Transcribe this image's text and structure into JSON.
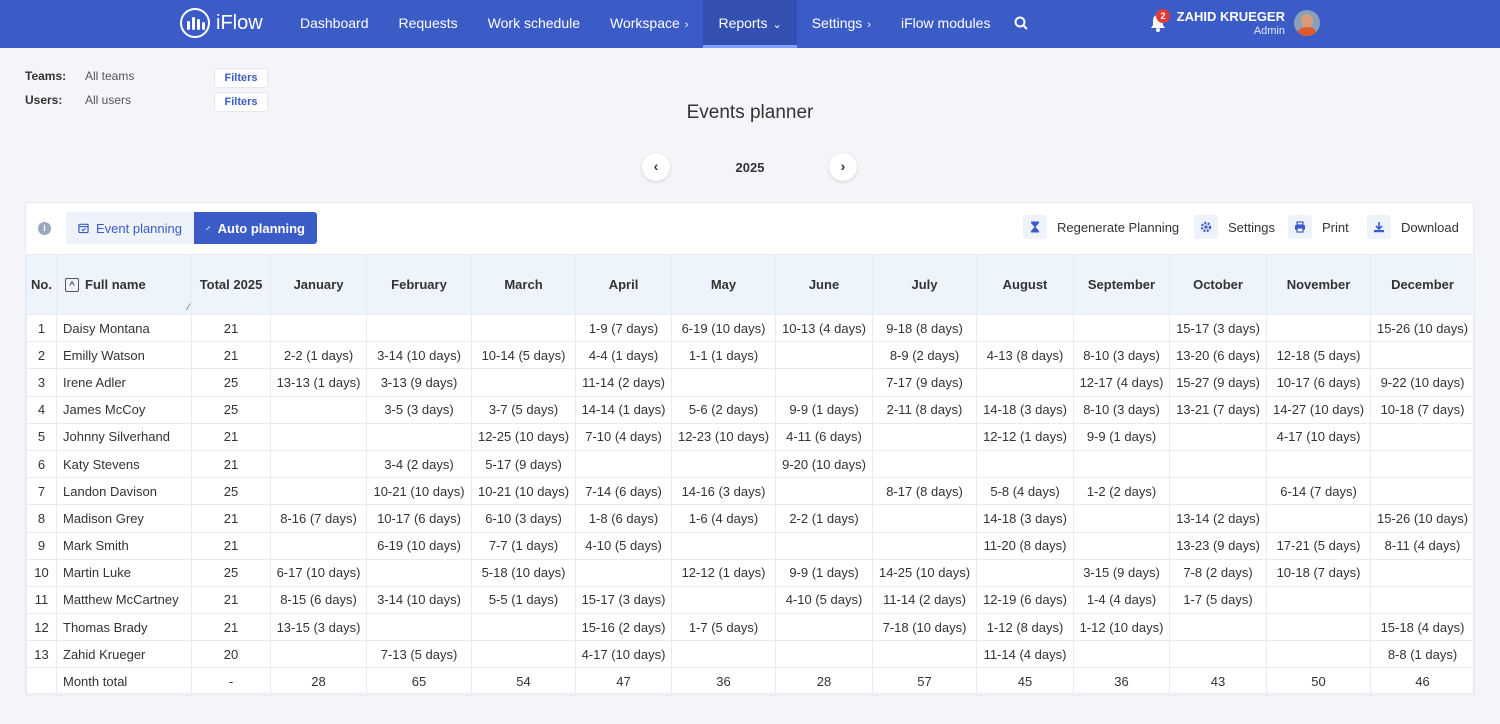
{
  "nav": {
    "logo_text": "iFlow",
    "menu": [
      {
        "label": "Dashboard",
        "caret": ""
      },
      {
        "label": "Requests",
        "caret": ""
      },
      {
        "label": "Work schedule",
        "caret": ""
      },
      {
        "label": "Workspace",
        "caret": "›"
      },
      {
        "label": "Reports",
        "caret": "⌄",
        "active": true
      },
      {
        "label": "Settings",
        "caret": "›"
      },
      {
        "label": "iFlow modules",
        "caret": ""
      }
    ],
    "notification_count": "2",
    "user_name": "ZAHID KRUEGER",
    "user_role": "Admin",
    "accent_color": "#3b5bc7"
  },
  "filters": {
    "teams_label": "Teams:",
    "teams_value": "All teams",
    "users_label": "Users:",
    "users_value": "All users",
    "button_label": "Filters"
  },
  "page": {
    "title": "Events planner",
    "year": "2025",
    "prev": "‹",
    "next": "›"
  },
  "toolbar": {
    "info": "i",
    "tab_event": "Event planning",
    "tab_auto": "Auto planning",
    "regenerate": "Regenerate Planning",
    "settings": "Settings",
    "print": "Print",
    "download": "Download"
  },
  "table": {
    "headers": [
      "No.",
      "Full name",
      "Total 2025",
      "January",
      "February",
      "March",
      "April",
      "May",
      "June",
      "July",
      "August",
      "September",
      "October",
      "November",
      "December"
    ],
    "sort_icon": "^",
    "rows": [
      [
        "1",
        "Daisy Montana",
        "21",
        "",
        "",
        "",
        "1-9 (7 days)",
        "6-19 (10 days)",
        "10-13 (4 days)",
        "9-18 (8 days)",
        "",
        "",
        "15-17 (3 days)",
        "",
        "15-26 (10 days)"
      ],
      [
        "2",
        "Emilly Watson",
        "21",
        "2-2 (1 days)",
        "3-14 (10 days)",
        "10-14 (5 days)",
        "4-4 (1 days)",
        "1-1 (1 days)",
        "",
        "8-9 (2 days)",
        "4-13 (8 days)",
        "8-10 (3 days)",
        "13-20 (6 days)",
        "12-18 (5 days)",
        ""
      ],
      [
        "3",
        "Irene Adler",
        "25",
        "13-13 (1 days)",
        "3-13 (9 days)",
        "",
        "11-14 (2 days)",
        "",
        "",
        "7-17 (9 days)",
        "",
        "12-17 (4 days)",
        "15-27 (9 days)",
        "10-17 (6 days)",
        "9-22 (10 days)"
      ],
      [
        "4",
        "James McCoy",
        "25",
        "",
        "3-5 (3 days)",
        "3-7 (5 days)",
        "14-14 (1 days)",
        "5-6 (2 days)",
        "9-9 (1 days)",
        "2-11 (8 days)",
        "14-18 (3 days)",
        "8-10 (3 days)",
        "13-21 (7 days)",
        "14-27 (10 days)",
        "10-18 (7 days)"
      ],
      [
        "5",
        "Johnny Silverhand",
        "21",
        "",
        "",
        "12-25 (10 days)",
        "7-10 (4 days)",
        "12-23 (10 days)",
        "4-11 (6 days)",
        "",
        "12-12 (1 days)",
        "9-9 (1 days)",
        "",
        "4-17 (10 days)",
        ""
      ],
      [
        "6",
        "Katy Stevens",
        "21",
        "",
        "3-4 (2 days)",
        "5-17 (9 days)",
        "",
        "",
        "9-20 (10 days)",
        "",
        "",
        "",
        "",
        "",
        ""
      ],
      [
        "7",
        "Landon Davison",
        "25",
        "",
        "10-21 (10 days)",
        "10-21 (10 days)",
        "7-14 (6 days)",
        "14-16 (3 days)",
        "",
        "8-17 (8 days)",
        "5-8 (4 days)",
        "1-2 (2 days)",
        "",
        "6-14 (7 days)",
        ""
      ],
      [
        "8",
        "Madison Grey",
        "21",
        "8-16 (7 days)",
        "10-17 (6 days)",
        "6-10 (3 days)",
        "1-8 (6 days)",
        "1-6 (4 days)",
        "2-2 (1 days)",
        "",
        "14-18 (3 days)",
        "",
        "13-14 (2 days)",
        "",
        "15-26 (10 days)"
      ],
      [
        "9",
        "Mark Smith",
        "21",
        "",
        "6-19 (10 days)",
        "7-7 (1 days)",
        "4-10 (5 days)",
        "",
        "",
        "",
        "11-20 (8 days)",
        "",
        "13-23 (9 days)",
        "17-21 (5 days)",
        "8-11 (4 days)"
      ],
      [
        "10",
        "Martin Luke",
        "25",
        "6-17 (10 days)",
        "",
        "5-18 (10 days)",
        "",
        "12-12 (1 days)",
        "9-9 (1 days)",
        "14-25 (10 days)",
        "",
        "3-15 (9 days)",
        "7-8 (2 days)",
        "10-18 (7 days)",
        ""
      ],
      [
        "11",
        "Matthew McCartney",
        "21",
        "8-15 (6 days)",
        "3-14 (10 days)",
        "5-5 (1 days)",
        "15-17 (3 days)",
        "",
        "4-10 (5 days)",
        "11-14 (2 days)",
        "12-19 (6 days)",
        "1-4 (4 days)",
        "1-7 (5 days)",
        "",
        ""
      ],
      [
        "12",
        "Thomas Brady",
        "21",
        "13-15 (3 days)",
        "",
        "",
        "15-16 (2 days)",
        "1-7 (5 days)",
        "",
        "7-18 (10 days)",
        "1-12 (8 days)",
        "1-12 (10 days)",
        "",
        "",
        "15-18 (4 days)"
      ],
      [
        "13",
        "Zahid Krueger",
        "20",
        "",
        "7-13 (5 days)",
        "",
        "4-17 (10 days)",
        "",
        "",
        "",
        "11-14 (4 days)",
        "",
        "",
        "",
        "8-8 (1 days)"
      ]
    ],
    "totals": [
      "",
      "Month total",
      "-",
      "28",
      "65",
      "54",
      "47",
      "36",
      "28",
      "57",
      "45",
      "36",
      "43",
      "50",
      "46"
    ]
  }
}
